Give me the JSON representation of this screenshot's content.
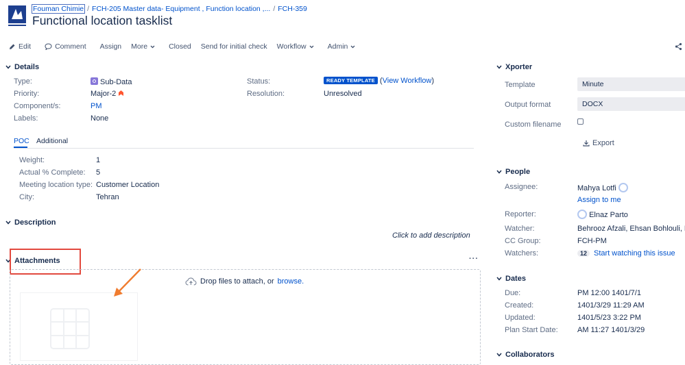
{
  "breadcrumb": {
    "project": "Fouman Chimie",
    "parent": "FCH-205 Master data- Equipment , Function location ,...",
    "issue_key": "FCH-359"
  },
  "page_title": "Functional location tasklist",
  "toolbar": {
    "edit": "Edit",
    "comment": "Comment",
    "assign": "Assign",
    "more": "More",
    "closed": "Closed",
    "send_check": "Send for initial check",
    "workflow": "Workflow",
    "admin": "Admin"
  },
  "details": {
    "heading": "Details",
    "type_label": "Type:",
    "type_value": "Sub-Data",
    "priority_label": "Priority:",
    "priority_value": "Major-2",
    "component_label": "Component/s:",
    "component_value": "PM",
    "labels_label": "Labels:",
    "labels_value": "None",
    "status_label": "Status:",
    "status_value": "READY TEMPLATE",
    "view_workflow": "View Workflow",
    "resolution_label": "Resolution:",
    "resolution_value": "Unresolved"
  },
  "tabs": {
    "poc": "POC",
    "additional": "Additional"
  },
  "poc": {
    "weight_label": "Weight:",
    "weight_value": "1",
    "actual_label": "Actual % Complete:",
    "actual_value": "5",
    "meeting_label": "Meeting location type:",
    "meeting_value": "Customer Location",
    "city_label": "City:",
    "city_value": "Tehran"
  },
  "description": {
    "heading": "Description",
    "placeholder": "Click to add description"
  },
  "attachments": {
    "heading": "Attachments",
    "drop_text": "Drop files to attach, or",
    "browse": "browse."
  },
  "xporter": {
    "heading": "Xporter",
    "template_label": "Template",
    "template_value": "Minute",
    "format_label": "Output format",
    "format_value": "DOCX",
    "filename_label": "Custom filename",
    "export": "Export"
  },
  "people": {
    "heading": "People",
    "assignee_label": "Assignee:",
    "assignee_value": "Mahya Lotfi",
    "assign_to_me": "Assign to me",
    "reporter_label": "Reporter:",
    "reporter_value": "Elnaz Parto",
    "watcher_label": "Watcher:",
    "watcher_value": "Behrooz Afzali, Ehsan Bohlouli, Elna",
    "ccgroup_label": "CC Group:",
    "ccgroup_value": "FCH-PM",
    "watchers_label": "Watchers:",
    "watchers_count": "12",
    "start_watching": "Start watching this issue"
  },
  "dates": {
    "heading": "Dates",
    "due_label": "Due:",
    "due_value": "PM 12:00 1401/7/1",
    "created_label": "Created:",
    "created_value": "1401/3/29 11:29 AM",
    "updated_label": "Updated:",
    "updated_value": "1401/5/23 3:22 PM",
    "planstart_label": "Plan Start Date:",
    "planstart_value": "AM 11:27 1401/3/29"
  },
  "collaborators": {
    "heading": "Collaborators"
  },
  "colors": {
    "link": "#0052cc",
    "highlight": "#e2483d",
    "arrow": "#f07c2f",
    "priority": "#ff5630"
  }
}
